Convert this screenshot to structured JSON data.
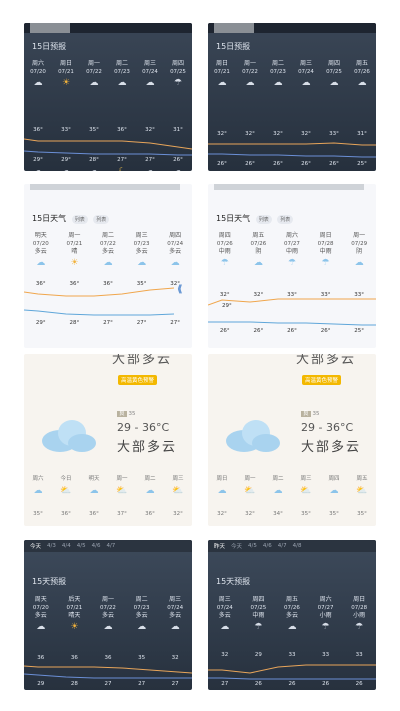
{
  "panels": {
    "p1": {
      "header": "15日预报",
      "days": [
        "周六",
        "周日",
        "周一",
        "周二",
        "周三",
        "周四"
      ],
      "dates": [
        "07/20",
        "07/21",
        "07/22",
        "07/23",
        "07/24",
        "07/25"
      ],
      "day_icons": [
        "cloud",
        "sun",
        "cloud",
        "cloud",
        "cloud",
        "rain"
      ],
      "highs": [
        "36°",
        "33°",
        "35°",
        "36°",
        "32°",
        "31°"
      ],
      "lows": [
        "29°",
        "29°",
        "28°",
        "27°",
        "27°",
        "26°"
      ],
      "night_icons": [
        "cloud",
        "cloud",
        "cloud",
        "moon",
        "cloud",
        "cloud"
      ]
    },
    "p2": {
      "header": "15日预报",
      "days": [
        "周日",
        "周一",
        "周二",
        "周三",
        "周四",
        "周五"
      ],
      "dates": [
        "07/21",
        "07/22",
        "07/23",
        "07/24",
        "07/25",
        "07/26"
      ],
      "day_icons": [
        "cloud",
        "cloud",
        "cloud",
        "cloud",
        "cloud",
        "cloud"
      ],
      "highs": [
        "32°",
        "32°",
        "32°",
        "32°",
        "33°",
        "31°"
      ],
      "lows": [
        "26°",
        "26°",
        "26°",
        "26°",
        "26°",
        "25°"
      ],
      "night_icons": [
        "moon",
        "moon",
        "cloud",
        "cloud",
        "cloud",
        "cloud"
      ]
    },
    "p3": {
      "header": "15日天气",
      "chips": [
        "列表",
        "列表"
      ],
      "days": [
        "明天",
        "周一",
        "周二",
        "周三",
        "周四"
      ],
      "dates": [
        "07/20",
        "07/21",
        "07/22",
        "07/23",
        "07/24"
      ],
      "weather": [
        "多云",
        "晴",
        "多云",
        "多云",
        "多云"
      ],
      "highs": [
        "36°",
        "36°",
        "36°",
        "35°",
        "32°"
      ],
      "lows": [
        "29°",
        "28°",
        "27°",
        "27°",
        "27°"
      ]
    },
    "p4": {
      "header": "15日天气",
      "chips": [
        "列表",
        "列表"
      ],
      "days": [
        "周四",
        "周五",
        "周六",
        "周日",
        "周一"
      ],
      "dates": [
        "07/26",
        "07/26",
        "07/27",
        "07/28",
        "07/29"
      ],
      "weather": [
        "中雨",
        "阴",
        "中雨",
        "中雨",
        "阴"
      ],
      "highs": [
        "32°",
        "32°",
        "33°",
        "33°",
        "33°"
      ],
      "lows": [
        "26°",
        "26°",
        "26°",
        "26°",
        "25°"
      ],
      "low_first": "29°"
    },
    "p5": {
      "title": "大部多云",
      "badge": "高温黄色预警",
      "aqi_badge": "良",
      "aqi_text": "35",
      "temp": "29 - 36°C",
      "desc": "大部多云",
      "mini_days": [
        "周六",
        "今日",
        "明天",
        "周一",
        "周二",
        "周三"
      ],
      "mini_highs": [
        "35°",
        "36°",
        "36°",
        "37°",
        "36°",
        "32°"
      ]
    },
    "p6": {
      "title": "大部多云",
      "badge": "高温黄色预警",
      "aqi_badge": "良",
      "aqi_text": "35",
      "temp": "29 - 36°C",
      "desc": "大部多云",
      "mini_days": [
        "周日",
        "周一",
        "周二",
        "周三",
        "周四",
        "周五"
      ],
      "mini_highs": [
        "32°",
        "32°",
        "34°",
        "35°",
        "35°",
        "35°"
      ]
    },
    "p7": {
      "tabs": [
        "今天",
        "4/3",
        "4/4",
        "4/5",
        "4/6",
        "4/7"
      ],
      "header": "15天预报",
      "days": [
        "周天",
        "后天",
        "周一",
        "周二",
        "周三"
      ],
      "dates": [
        "07/20",
        "07/21",
        "07/22",
        "07/23",
        "07/24"
      ],
      "weather": [
        "多云",
        "晴天",
        "多云",
        "多云",
        "多云"
      ],
      "highs": [
        "36",
        "36",
        "36",
        "35",
        "32"
      ],
      "lows": [
        "29",
        "28",
        "27",
        "27",
        "27"
      ]
    },
    "p8": {
      "tabs": [
        "昨天",
        "今天",
        "4/5",
        "4/6",
        "4/7",
        "4/8"
      ],
      "header": "15天预报",
      "days": [
        "周三",
        "周四",
        "周五",
        "周六",
        "周日"
      ],
      "dates": [
        "07/24",
        "07/25",
        "07/26",
        "07/27",
        "07/28"
      ],
      "weather": [
        "多云",
        "中雨",
        "多云",
        "小雨",
        "小雨"
      ],
      "highs": [
        "32",
        "29",
        "33",
        "33",
        "33"
      ],
      "lows": [
        "27",
        "26",
        "26",
        "26",
        "26"
      ]
    }
  }
}
